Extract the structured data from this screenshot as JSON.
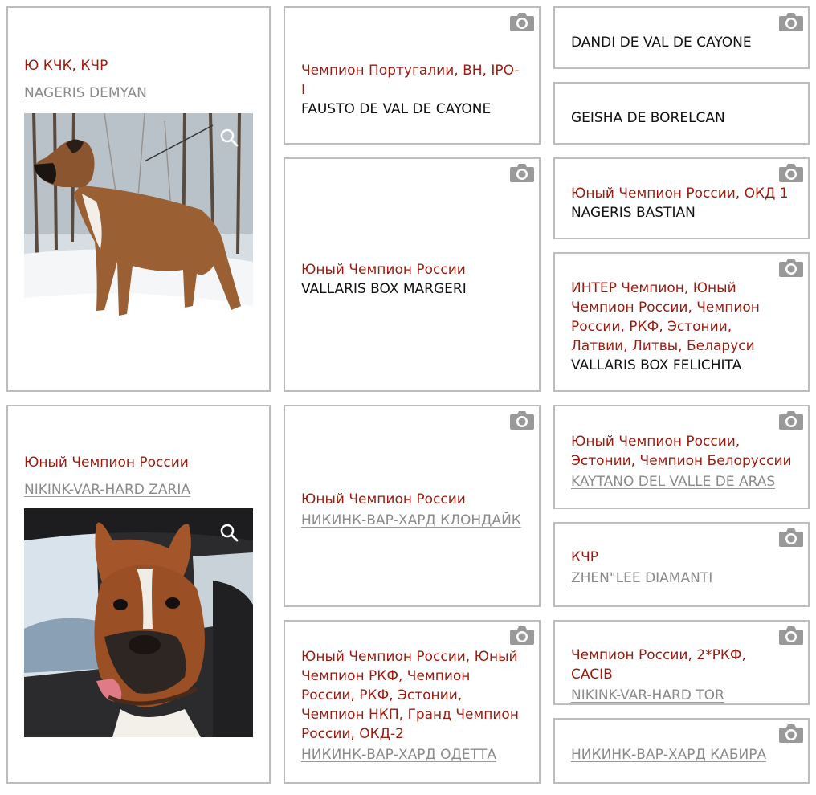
{
  "colors": {
    "title": "#9b1b0e",
    "border": "#bdbdbd",
    "link": "#8a8a8a",
    "camera_icon": "#999999"
  },
  "pedigrees": [
    {
      "dog": {
        "title": "Ю КЧК, КЧР",
        "name": "NAGERIS DEMYAN",
        "photo_icon": "zoom-icon"
      },
      "sire": {
        "title": "Чемпион Португалии, ВН, IPO-I",
        "name": "FAUSTO DE VAL DE CAYONE"
      },
      "dam": {
        "title": "Юный Чемпион России",
        "name": "VALLARIS BOX MARGERI"
      },
      "sire_sire": {
        "title": "",
        "name": "DANDI DE VAL DE CAYONE"
      },
      "sire_dam": {
        "title": "",
        "name": "GEISHA DE BORELCAN"
      },
      "dam_sire": {
        "title": "Юный Чемпион России, ОКД 1",
        "name": "NAGERIS BASTIAN"
      },
      "dam_dam": {
        "title": "ИНТЕР Чемпион, Юный Чемпион России, Чемпион России, РКФ, Эстонии, Латвии, Литвы, Беларуси",
        "name": "VALLARIS BOX FELICHITA"
      }
    },
    {
      "dog": {
        "title": "Юный Чемпион России",
        "name": "NIKINK-VAR-HARD ZARIA",
        "photo_icon": "zoom-icon"
      },
      "sire": {
        "title": "Юный Чемпион России",
        "name": "НИКИНК-ВАР-ХАРД КЛОНДАЙК"
      },
      "dam": {
        "title": "Юный Чемпион России, Юный Чемпион РКФ, Чемпион России, РКФ, Эстонии, Чемпион НКП, Гранд Чемпион России, ОКД-2",
        "name": "НИКИНК-ВАР-ХАРД ОДЕТТА"
      },
      "sire_sire": {
        "title": "Юный Чемпион России, Эстонии, Чемпион Белоруссии",
        "name": "KAYTANO DEL VALLE DE ARAS"
      },
      "sire_dam": {
        "title": "КЧР",
        "name": "ZHEN\"LEE DIAMANTI"
      },
      "dam_sire": {
        "title": "Чемпион России, 2*РКФ, CACIB",
        "name": "NIKINK-VAR-HARD TOR"
      },
      "dam_dam": {
        "title": "",
        "name": "НИКИНК-ВАР-ХАРД КАБИРА"
      }
    }
  ]
}
